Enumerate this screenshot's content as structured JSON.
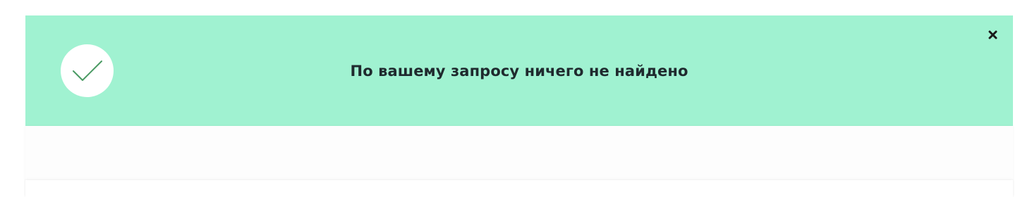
{
  "notice": {
    "message": "По вашему запросу ничего не найдено",
    "status_icon": "check-icon",
    "close_icon": "close-icon",
    "background_color": "#a0f2d1",
    "check_color": "#4a9a63"
  }
}
